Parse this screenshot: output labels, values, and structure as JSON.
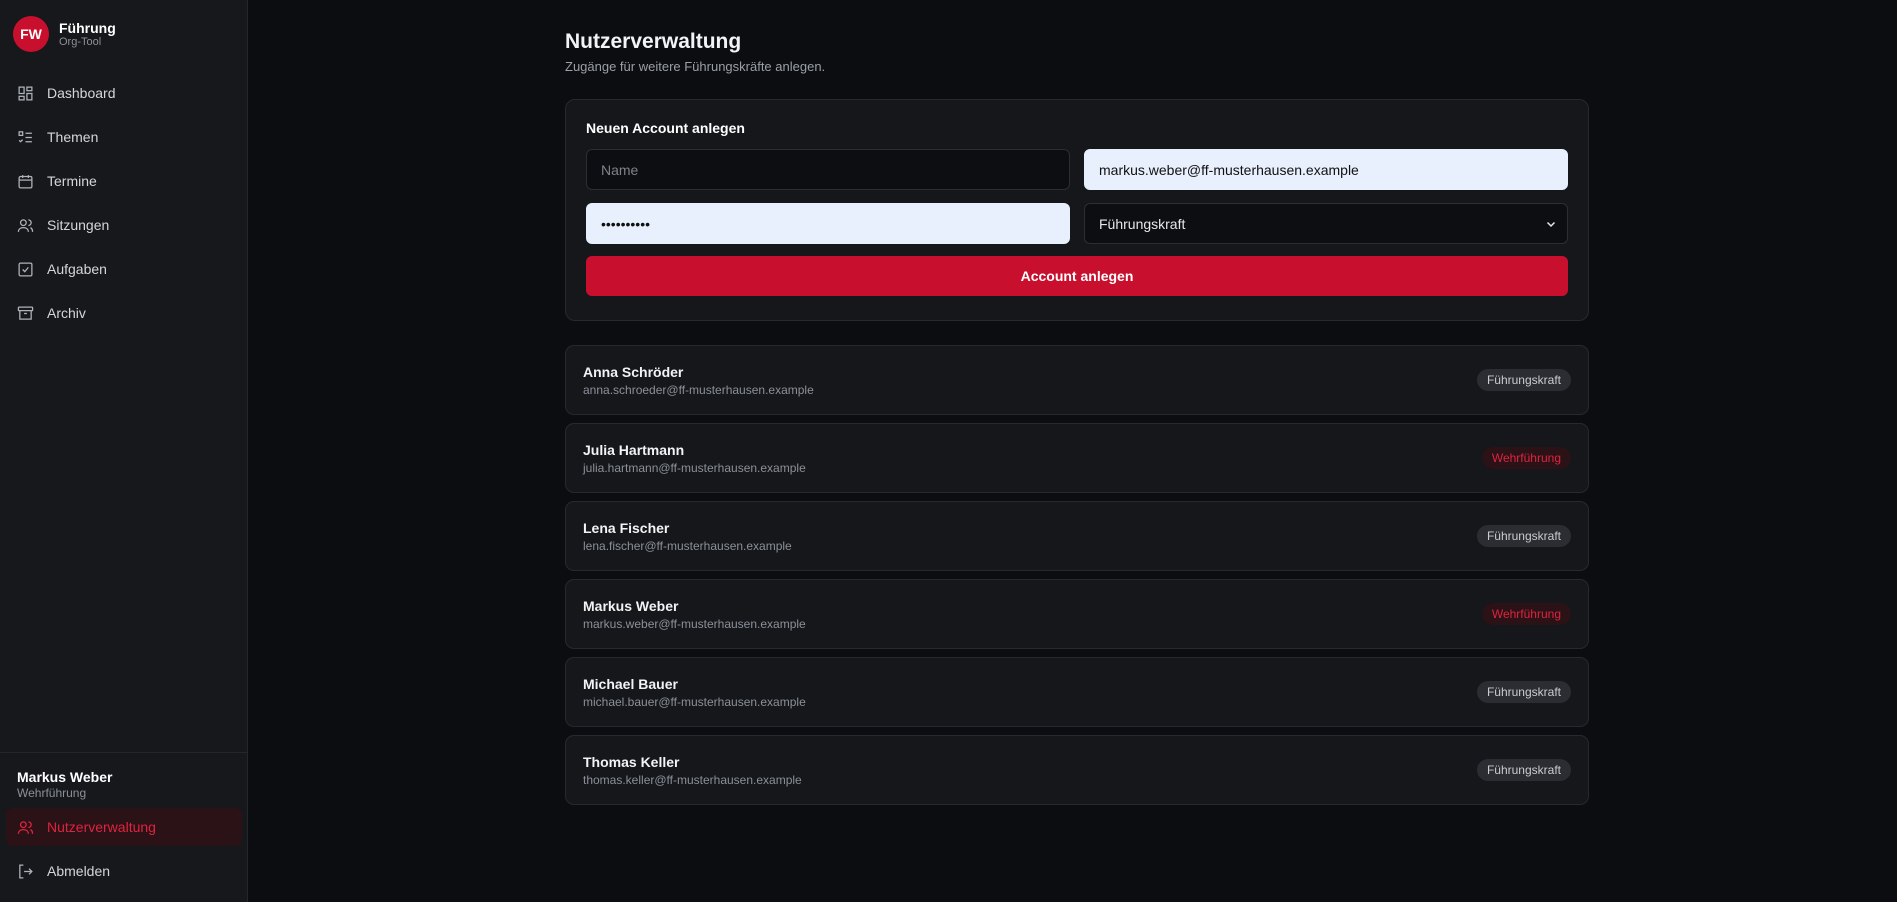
{
  "brand": {
    "initials": "FW",
    "title": "Führung",
    "subtitle": "Org-Tool"
  },
  "nav": [
    {
      "label": "Dashboard",
      "icon": "dashboard-icon"
    },
    {
      "label": "Themen",
      "icon": "list-icon"
    },
    {
      "label": "Termine",
      "icon": "calendar-icon"
    },
    {
      "label": "Sitzungen",
      "icon": "users-icon"
    },
    {
      "label": "Aufgaben",
      "icon": "checkbox-icon"
    },
    {
      "label": "Archiv",
      "icon": "archive-icon"
    }
  ],
  "current_user": {
    "name": "Markus Weber",
    "role": "Wehrführung"
  },
  "bottom_nav": [
    {
      "label": "Nutzerverwaltung",
      "icon": "users-icon",
      "active": true
    },
    {
      "label": "Abmelden",
      "icon": "logout-icon"
    }
  ],
  "page": {
    "title": "Nutzerverwaltung",
    "subtitle": "Zugänge für weitere Führungskräfte anlegen."
  },
  "form": {
    "title": "Neuen Account anlegen",
    "name_placeholder": "Name",
    "email_value": "markus.weber@ff-musterhausen.example",
    "password_value": "••••••••••",
    "role_value": "Führungskraft",
    "submit_label": "Account anlegen"
  },
  "users": [
    {
      "name": "Anna Schröder",
      "email": "anna.schroeder@ff-musterhausen.example",
      "role": "Führungskraft"
    },
    {
      "name": "Julia Hartmann",
      "email": "julia.hartmann@ff-musterhausen.example",
      "role": "Wehrführung"
    },
    {
      "name": "Lena Fischer",
      "email": "lena.fischer@ff-musterhausen.example",
      "role": "Führungskraft"
    },
    {
      "name": "Markus Weber",
      "email": "markus.weber@ff-musterhausen.example",
      "role": "Wehrführung"
    },
    {
      "name": "Michael Bauer",
      "email": "michael.bauer@ff-musterhausen.example",
      "role": "Führungskraft"
    },
    {
      "name": "Thomas Keller",
      "email": "thomas.keller@ff-musterhausen.example",
      "role": "Führungskraft"
    }
  ],
  "colors": {
    "accent": "#c8102e",
    "background": "#0c0d10",
    "sidebar": "#16181c",
    "card": "#15171b"
  }
}
